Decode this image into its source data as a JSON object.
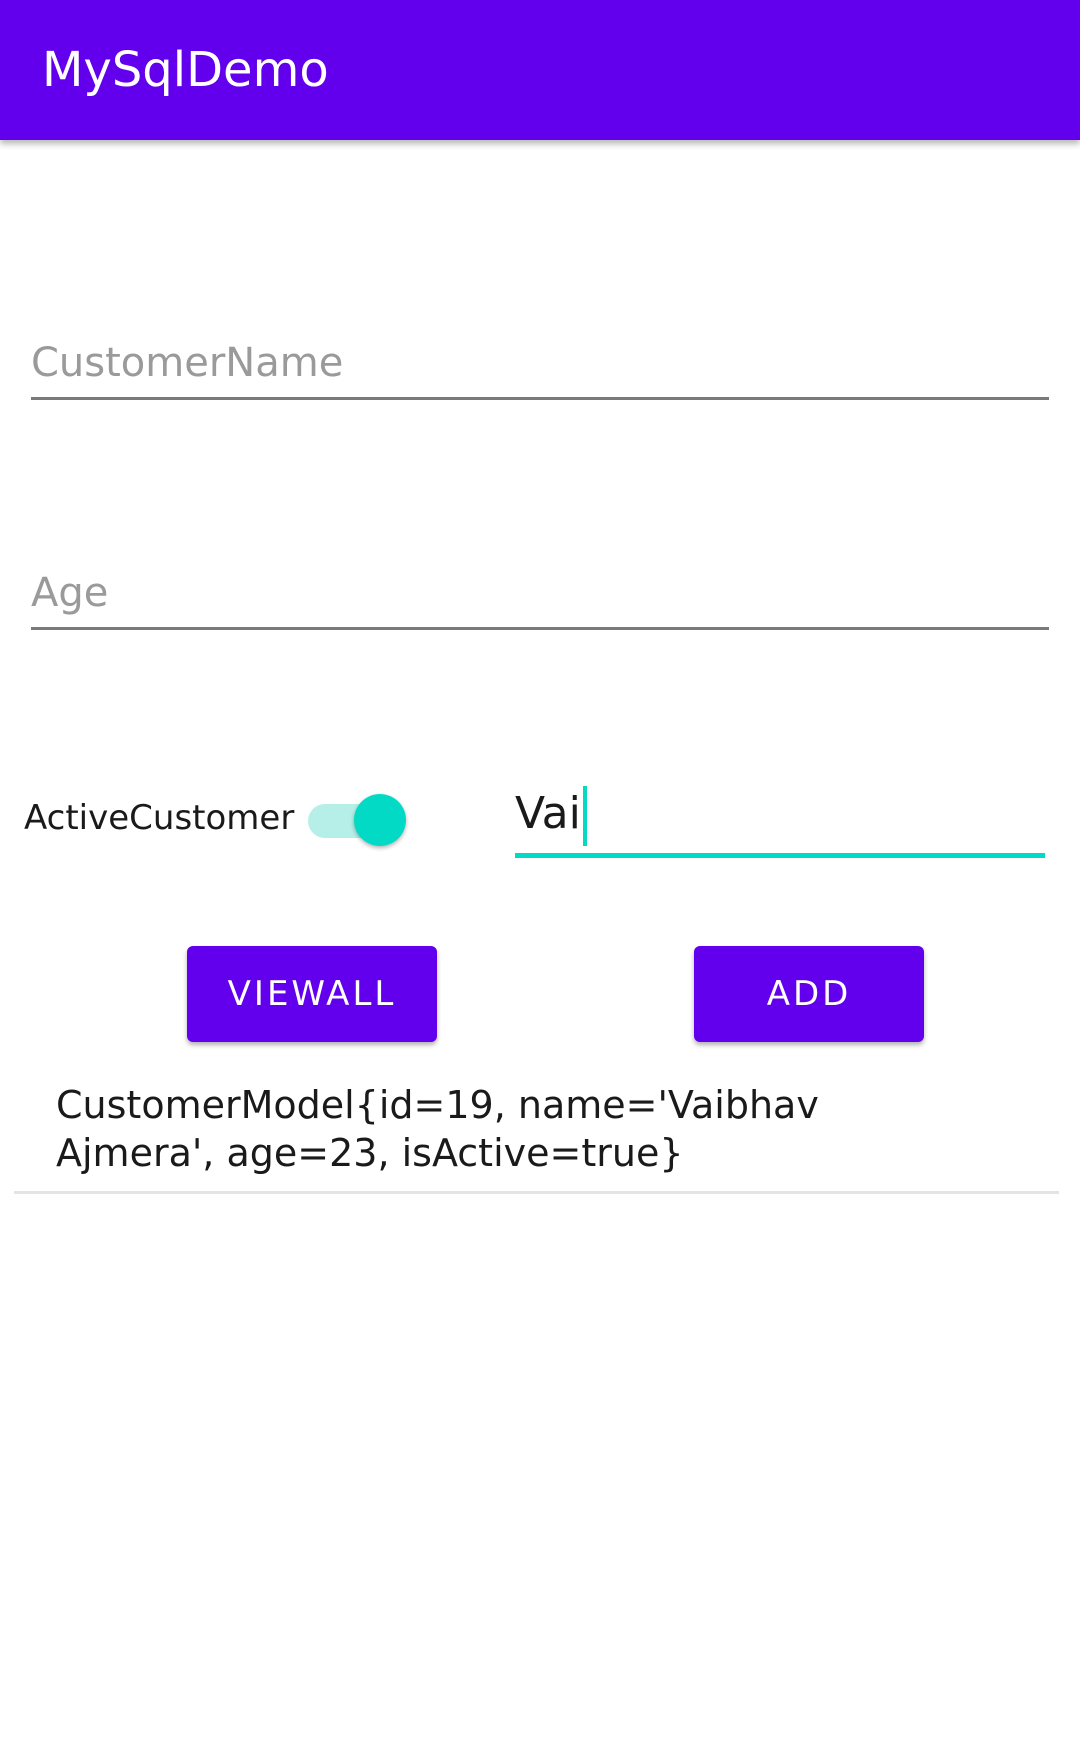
{
  "app_bar": {
    "title": "MySqlDemo",
    "background_color": "#6200ee"
  },
  "form": {
    "customer_name": {
      "placeholder": "CustomerName",
      "value": ""
    },
    "age": {
      "placeholder": "Age",
      "value": ""
    },
    "active_customer": {
      "label": "ActiveCustomer",
      "checked": true,
      "accent_color": "#03dac5"
    },
    "search": {
      "value": "Vai"
    }
  },
  "buttons": {
    "view_all": "VIEWALL",
    "add": "ADD"
  },
  "list": {
    "items": [
      "CustomerModel{id=19, name='Vaibhav Ajmera', age=23, isActive=true}"
    ]
  }
}
